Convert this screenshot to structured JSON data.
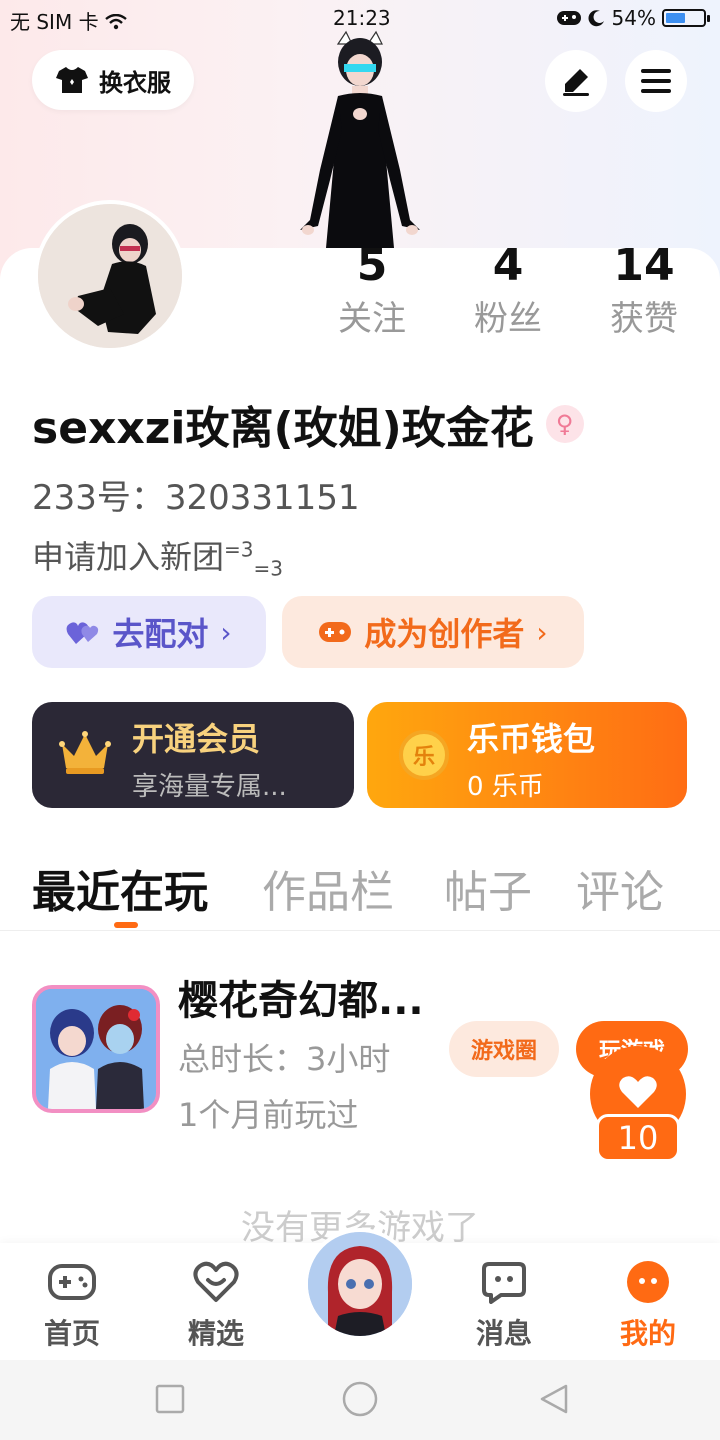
{
  "status_bar": {
    "carrier": "无 SIM 卡",
    "time": "21:23",
    "battery": "54%",
    "battery_level": 0.54
  },
  "header": {
    "dress_button": "换衣服"
  },
  "stats": [
    {
      "count": "5",
      "label": "关注"
    },
    {
      "count": "4",
      "label": "粉丝"
    },
    {
      "count": "14",
      "label": "获赞"
    }
  ],
  "profile": {
    "username": "sexxzi玫离(玫姐)玫金花",
    "gender_symbol": "♀",
    "uid": "233号：320331151",
    "bio": "申请加入新团",
    "bio_emoticon_1": "=3",
    "bio_emoticon_2": "=3"
  },
  "actions": {
    "match": "去配对",
    "creator": "成为创作者"
  },
  "cards": {
    "vip_title": "开通会员",
    "vip_sub": "享海量专属...",
    "wallet_title": "乐币钱包",
    "wallet_sub": "0 乐币",
    "coin_glyph": "乐"
  },
  "tabs": [
    "最近在玩",
    "作品栏",
    "帖子",
    "评论"
  ],
  "games": [
    {
      "name": "樱花奇幻都...",
      "total_time": "总时长：3小时",
      "last_played": "1个月前玩过",
      "circle_button": "游戏圈",
      "play_button": "玩游戏"
    }
  ],
  "like_count": "10",
  "no_more": "没有更多游戏了",
  "bottom_nav": [
    {
      "label": "首页"
    },
    {
      "label": "精选"
    },
    {
      "label": "消息"
    },
    {
      "label": "我的"
    }
  ],
  "colors": {
    "accent": "#ff6a13",
    "purple": "#5a55c9",
    "vip_bg": "#2b2836",
    "gold": "#ffa70e"
  }
}
